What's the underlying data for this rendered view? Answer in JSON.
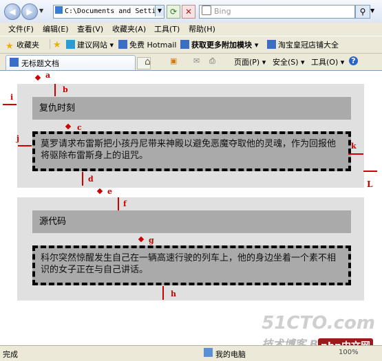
{
  "browser": {
    "address": "C:\\Documents and Setting",
    "search_placeholder": "Bing",
    "menus": [
      "文件(F)",
      "编辑(E)",
      "查看(V)",
      "收藏夹(A)",
      "工具(T)",
      "帮助(H)"
    ],
    "favorites_label": "收藏夹",
    "fav_items": [
      "建议网站 ▾",
      "免费 Hotmail",
      "获取更多附加模块 ▾",
      "淘宝皇冠店铺大全"
    ],
    "tab_title": "无标题文档",
    "commands": [
      "页面(P) ▾",
      "安全(S) ▾",
      "工具(O) ▾"
    ],
    "status_left": "完成",
    "status_zone": "我的电脑",
    "zoom": "100%",
    "watermark": "51CTO.com",
    "watermark_sub": "技术博客 Blog",
    "watermark_logo": "php中文网"
  },
  "content": {
    "section1": {
      "heading": "复仇时刻",
      "body": "莫罗请求布雷斯把小孩丹尼带来神殿以避免恶魔夺取他的灵魂，作为回报他将驱除布雷斯身上的诅咒。"
    },
    "section2": {
      "heading": "源代码",
      "body": "科尔突然惊醒发生自己在一辆高速行驶的列车上，他的身边坐着一个素不相识的女子正在与自己讲话。"
    }
  },
  "annotations": [
    "a",
    "b",
    "c",
    "d",
    "e",
    "f",
    "g",
    "h",
    "i",
    "j",
    "k",
    "L"
  ],
  "colors": {
    "annotation": "#cc0000",
    "section_bg": "#e0e0e0",
    "block_bg": "#aaaaaa"
  }
}
